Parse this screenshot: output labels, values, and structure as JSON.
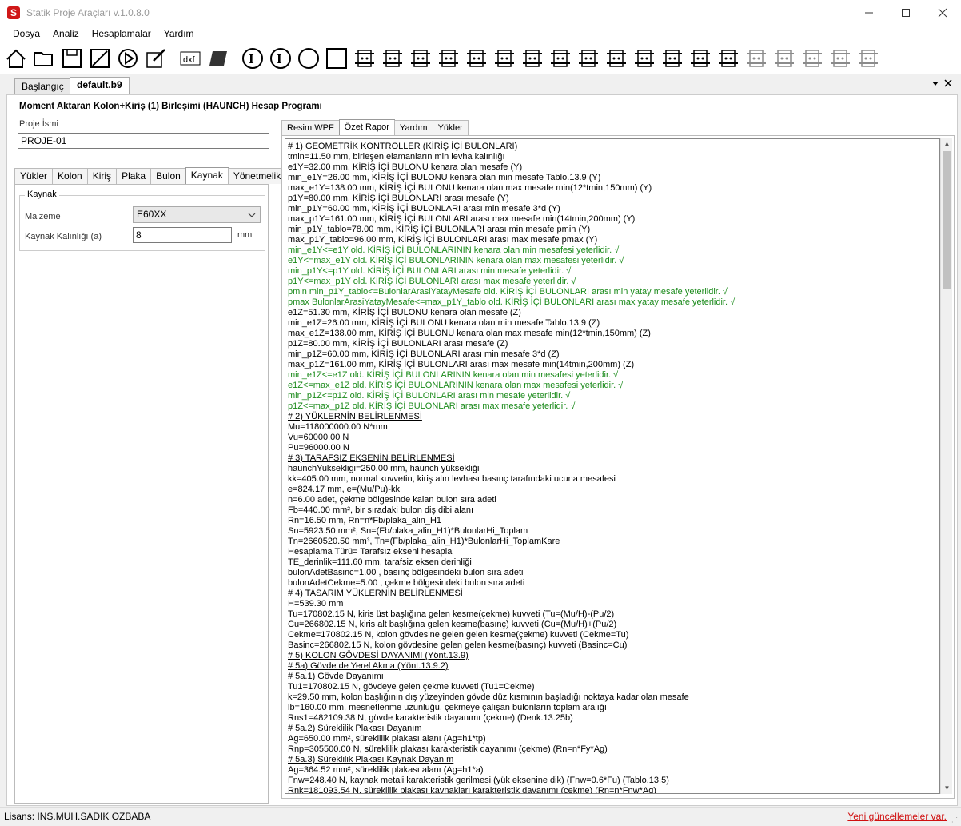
{
  "window": {
    "title": "Statik Proje Araçları v.1.0.8.0",
    "minimize_icon": "minimize-icon",
    "maximize_icon": "maximize-icon",
    "close_icon": "close-icon"
  },
  "menu": [
    "Dosya",
    "Analiz",
    "Hesaplamalar",
    "Yardım"
  ],
  "toolbar_icons": [
    "home-icon",
    "open-folder-icon",
    "save-icon",
    "save-as-icon",
    "run-icon",
    "edit-icon",
    "dxf-export-icon",
    "3d-shape-icon",
    "i-section-icon",
    "i-section-bold-icon",
    "circle-section-icon",
    "square-section-icon",
    "beam-support-icon",
    "plate-icon",
    "k-plate-icon",
    "column-beam-icon",
    "moment-connection-icon",
    "beam-splice-icon",
    "base-plate-icon",
    "bolt-group-icon",
    "haunch-icon",
    "beam-column-icon",
    "column-splice-icon",
    "stiffener-icon",
    "end-plate-icon",
    "web-plate-icon",
    "angle-connection-icon",
    "bolt-row-icon",
    "u-channel-icon",
    "t-section-icon",
    "i-profile-icon"
  ],
  "doc_tabs": {
    "start": "Başlangıç",
    "active": "default.b9",
    "dropdown_icon": "dropdown-icon",
    "close_icon": "close-icon"
  },
  "program_title": "Moment Aktaran Kolon+Kiriş (1) Birleşimi (HAUNCH) Hesap Programı",
  "project": {
    "label": "Proje İsmi",
    "value": "PROJE-01"
  },
  "left_tabs": [
    "Yükler",
    "Kolon",
    "Kiriş",
    "Plaka",
    "Bulon",
    "Kaynak",
    "Yönetmelik"
  ],
  "left_tab_active": "Kaynak",
  "weld": {
    "group_title": "Kaynak",
    "material_label": "Malzeme",
    "material_value": "E60XX",
    "thickness_label": "Kaynak Kalınlığı (a)",
    "thickness_value": "8",
    "thickness_unit": "mm"
  },
  "right_tabs": [
    "Resim WPF",
    "Özet Rapor",
    "Yardım",
    "Yükler"
  ],
  "right_tab_active": "Özet Rapor",
  "report": [
    {
      "t": "# 1) GEOMETRİK KONTROLLER (KİRİŞ İÇİ BULONLARI)",
      "s": "h"
    },
    {
      "t": "tmin=11.50 mm, birleşen elamanların min levha kalınlığı",
      "s": ""
    },
    {
      "t": "e1Y=32.00 mm, KİRİŞ İÇİ BULONU kenara olan mesafe (Y)",
      "s": ""
    },
    {
      "t": "min_e1Y=26.00 mm, KİRİŞ İÇİ BULONU kenara olan min mesafe Tablo.13.9 (Y)",
      "s": ""
    },
    {
      "t": "max_e1Y=138.00 mm, KİRİŞ İÇİ BULONU kenara olan max mesafe min(12*tmin,150mm) (Y)",
      "s": ""
    },
    {
      "t": "p1Y=80.00 mm, KİRİŞ İÇİ BULONLARI arası mesafe (Y)",
      "s": ""
    },
    {
      "t": "min_p1Y=60.00 mm, KİRİŞ İÇİ BULONLARI arası min mesafe 3*d (Y)",
      "s": ""
    },
    {
      "t": "max_p1Y=161.00 mm, KİRİŞ İÇİ BULONLARI arası max mesafe min(14tmin,200mm) (Y)",
      "s": ""
    },
    {
      "t": "min_p1Y_tablo=78.00 mm, KİRİŞ İÇİ BULONLARI arası min mesafe pmin (Y)",
      "s": ""
    },
    {
      "t": "max_p1Y_tablo=96.00 mm, KİRİŞ İÇİ BULONLARI arası max mesafe pmax (Y)",
      "s": ""
    },
    {
      "t": "min_e1Y<=e1Y old. KİRİŞ İÇİ BULONLARININ kenara olan min mesafesi yeterlidir. √",
      "s": "g"
    },
    {
      "t": "e1Y<=max_e1Y old. KİRİŞ İÇİ BULONLARININ kenara olan max mesafesi yeterlidir. √",
      "s": "g"
    },
    {
      "t": "min_p1Y<=p1Y old. KİRİŞ İÇİ BULONLARI arası min mesafe yeterlidir. √",
      "s": "g"
    },
    {
      "t": "p1Y<=max_p1Y old. KİRİŞ İÇİ BULONLARI arası max mesafe yeterlidir. √",
      "s": "g"
    },
    {
      "t": "pmin min_p1Y_tablo<=BulonlarArasiYatayMesafe old. KİRİŞ İÇİ BULONLARI arası min yatay mesafe yeterlidir. √",
      "s": "g"
    },
    {
      "t": "pmax BulonlarArasiYatayMesafe<=max_p1Y_tablo old. KİRİŞ İÇİ BULONLARI arası max yatay mesafe yeterlidir. √",
      "s": "g"
    },
    {
      "t": "e1Z=51.30 mm, KİRİŞ İÇİ BULONU kenara olan mesafe (Z)",
      "s": ""
    },
    {
      "t": "min_e1Z=26.00 mm, KİRİŞ İÇİ BULONU kenara olan min mesafe Tablo.13.9 (Z)",
      "s": ""
    },
    {
      "t": "max_e1Z=138.00 mm, KİRİŞ İÇİ BULONU kenara olan max mesafe min(12*tmin,150mm) (Z)",
      "s": ""
    },
    {
      "t": "p1Z=80.00 mm, KİRİŞ İÇİ BULONLARI arası mesafe (Z)",
      "s": ""
    },
    {
      "t": "min_p1Z=60.00 mm, KİRİŞ İÇİ BULONLARI arası min mesafe 3*d (Z)",
      "s": ""
    },
    {
      "t": "max_p1Z=161.00 mm, KİRİŞ İÇİ BULONLARI arası max mesafe min(14tmin,200mm) (Z)",
      "s": ""
    },
    {
      "t": "min_e1Z<=e1Z old. KİRİŞ İÇİ BULONLARININ kenara olan min mesafesi yeterlidir. √",
      "s": "g"
    },
    {
      "t": "e1Z<=max_e1Z old. KİRİŞ İÇİ BULONLARININ kenara olan max mesafesi yeterlidir. √",
      "s": "g"
    },
    {
      "t": "min_p1Z<=p1Z old. KİRİŞ İÇİ BULONLARI arası min mesafe yeterlidir. √",
      "s": "g"
    },
    {
      "t": "p1Z<=max_p1Z old. KİRİŞ İÇİ BULONLARI arası max mesafe yeterlidir. √",
      "s": "g"
    },
    {
      "t": "# 2) YÜKLERNİN BELİRLENMESİ",
      "s": "h"
    },
    {
      "t": "Mu=118000000.00 N*mm",
      "s": ""
    },
    {
      "t": "Vu=60000.00 N",
      "s": ""
    },
    {
      "t": "Pu=96000.00 N",
      "s": ""
    },
    {
      "t": "# 3) TARAFSIZ EKSENİN BELİRLENMESİ",
      "s": "h"
    },
    {
      "t": "haunchYuksekligi=250.00 mm, haunch yüksekliği",
      "s": ""
    },
    {
      "t": "kk=405.00 mm, normal kuvvetin, kiriş alın levhası basınç tarafındaki ucuna mesafesi",
      "s": ""
    },
    {
      "t": "e=824.17 mm, e=(Mu/Pu)-kk",
      "s": ""
    },
    {
      "t": "n=6.00 adet, çekme bölgesinde kalan bulon sıra adeti",
      "s": ""
    },
    {
      "t": "Fb=440.00 mm², bir sıradaki bulon diş dibi alanı",
      "s": ""
    },
    {
      "t": "Rn=16.50 mm, Rn=n*Fb/plaka_alin_H1",
      "s": ""
    },
    {
      "t": "Sn=5923.50 mm², Sn=(Fb/plaka_alin_H1)*BulonlarHi_Toplam",
      "s": ""
    },
    {
      "t": "Tn=2660520.50 mm³, Tn=(Fb/plaka_alin_H1)*BulonlarHi_ToplamKare",
      "s": ""
    },
    {
      "t": "Hesaplama Türü= Tarafsız ekseni hesapla",
      "s": ""
    },
    {
      "t": "TE_derinlik=111.60 mm, tarafsiz eksen derinliği",
      "s": ""
    },
    {
      "t": "bulonAdetBasinc=1.00 , basınç bölgesindeki bulon sıra adeti",
      "s": ""
    },
    {
      "t": "bulonAdetCekme=5.00 , çekme bölgesindeki bulon sıra adeti",
      "s": ""
    },
    {
      "t": "# 4) TASARIM YÜKLERNİN BELİRLENMESİ",
      "s": "h"
    },
    {
      "t": "H=539.30 mm",
      "s": ""
    },
    {
      "t": "Tu=170802.15 N, kiris üst başlığına gelen kesme(çekme) kuvveti (Tu=(Mu/H)-(Pu/2)",
      "s": ""
    },
    {
      "t": "Cu=266802.15 N, kiris alt başlığına gelen kesme(basınç) kuvveti (Cu=(Mu/H)+(Pu/2)",
      "s": ""
    },
    {
      "t": "Cekme=170802.15 N, kolon gövdesine gelen gelen kesme(çekme) kuvveti (Cekme=Tu)",
      "s": ""
    },
    {
      "t": "Basinc=266802.15 N, kolon gövdesine gelen gelen kesme(basınç) kuvveti (Basinc=Cu)",
      "s": ""
    },
    {
      "t": "# 5) KOLON GÖVDESİ DAYANIMI (Yönt.13.9)",
      "s": "h"
    },
    {
      "t": "# 5a) Gövde de Yerel Akma (Yönt.13.9.2)",
      "s": "h"
    },
    {
      "t": "# 5a.1) Gövde Dayanımı",
      "s": "h"
    },
    {
      "t": "Tu1=170802.15 N, gövdeye gelen çekme kuvveti (Tu1=Cekme)",
      "s": ""
    },
    {
      "t": "k=29.50 mm, kolon başlığının dış yüzeyinden gövde düz kısmının başladığı noktaya kadar olan mesafe",
      "s": ""
    },
    {
      "t": "lb=160.00 mm, mesnetlenme uzunluğu, çekmeye çalışan bulonların toplam aralığı",
      "s": ""
    },
    {
      "t": "Rns1=482109.38 N, gövde karakteristik dayanımı (çekme) (Denk.13.25b)",
      "s": ""
    },
    {
      "t": "# 5a.2) Süreklilik Plakası Dayanım",
      "s": "h"
    },
    {
      "t": "Ag=650.00 mm², süreklilik plakası alanı (Ag=h1*tp)",
      "s": ""
    },
    {
      "t": "Rnp=305500.00 N, süreklilik plakası karakteristik dayanımı (çekme) (Rn=n*Fy*Ag)",
      "s": ""
    },
    {
      "t": "# 5a.3) Süreklilik Plakası Kaynak Dayanım",
      "s": "h"
    },
    {
      "t": "Ag=364.52 mm², süreklilik plakası alanı (Ag=h1*a)",
      "s": ""
    },
    {
      "t": "Fnw=248.40 N, kaynak metali karakteristik gerilmesi (yük eksenine dik) (Fnw=0.6*Fu) (Tablo.13.5)",
      "s": ""
    },
    {
      "t": "Rnk=181093.54 N, süreklilik plakası kaynakları karakteristik dayanımı (çekme) (Rn=n*Fnw*Ag)",
      "s": ""
    }
  ],
  "status": {
    "license": "Lisans: INS.MUH.SADIK OZBABA",
    "update_link": "Yeni güncellemeler var."
  },
  "colors": {
    "accent_green": "#1a8a1a",
    "update_red": "#d01010",
    "app_icon_red": "#d01818"
  }
}
